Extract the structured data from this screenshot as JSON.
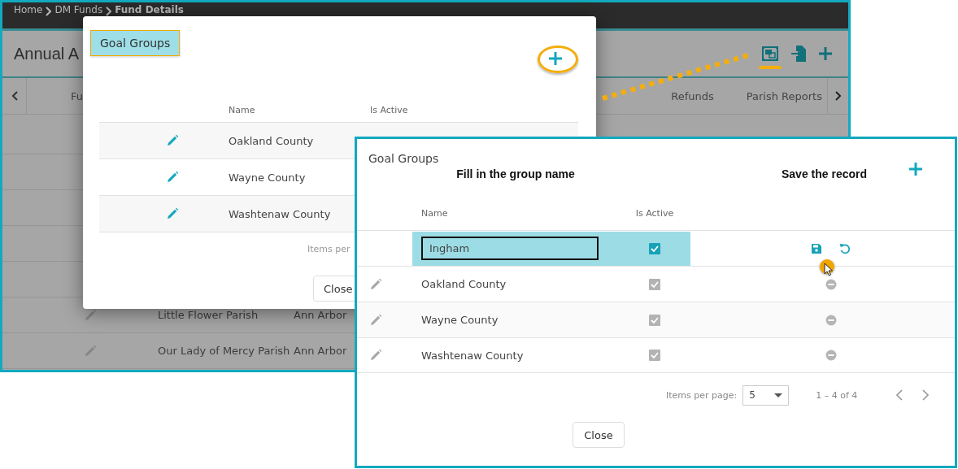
{
  "app": {
    "breadcrumbs": [
      {
        "label": "Home",
        "current": false
      },
      {
        "label": "DM Funds",
        "current": false
      },
      {
        "label": "Fund Details",
        "current": true
      }
    ],
    "title": "Annual A",
    "tabs": [
      "Fu",
      "Refunds",
      "Parish Reports"
    ],
    "rows": [
      {
        "column_1": "Little Flower Parish",
        "column_2": "Ann Arbor"
      },
      {
        "column_1": "Our Lady of Mercy Parish",
        "column_2": "Ann Arbor"
      }
    ]
  },
  "dialog": {
    "title": "Goal Groups",
    "columns": [
      "Name",
      "Is Active"
    ],
    "rows": [
      {
        "name": "Oakland County"
      },
      {
        "name": "Wayne County"
      },
      {
        "name": "Washtenaw County"
      }
    ],
    "pagination_label": "Items per",
    "close": "Close"
  },
  "panel": {
    "title": "Goal Groups",
    "callouts": [
      "Fill in the group name",
      "Save the record"
    ],
    "columns": [
      "Name",
      "Is Active"
    ],
    "new_row": {
      "name": "Ingham",
      "active": true
    },
    "rows": [
      {
        "name": "Oakland County",
        "active": true
      },
      {
        "name": "Wayne County",
        "active": true
      },
      {
        "name": "Washtenaw County",
        "active": true
      }
    ],
    "items_per_page_label": "Items per page:",
    "page_size": "5",
    "range": "1 – 4 of 4",
    "close": "Close"
  }
}
